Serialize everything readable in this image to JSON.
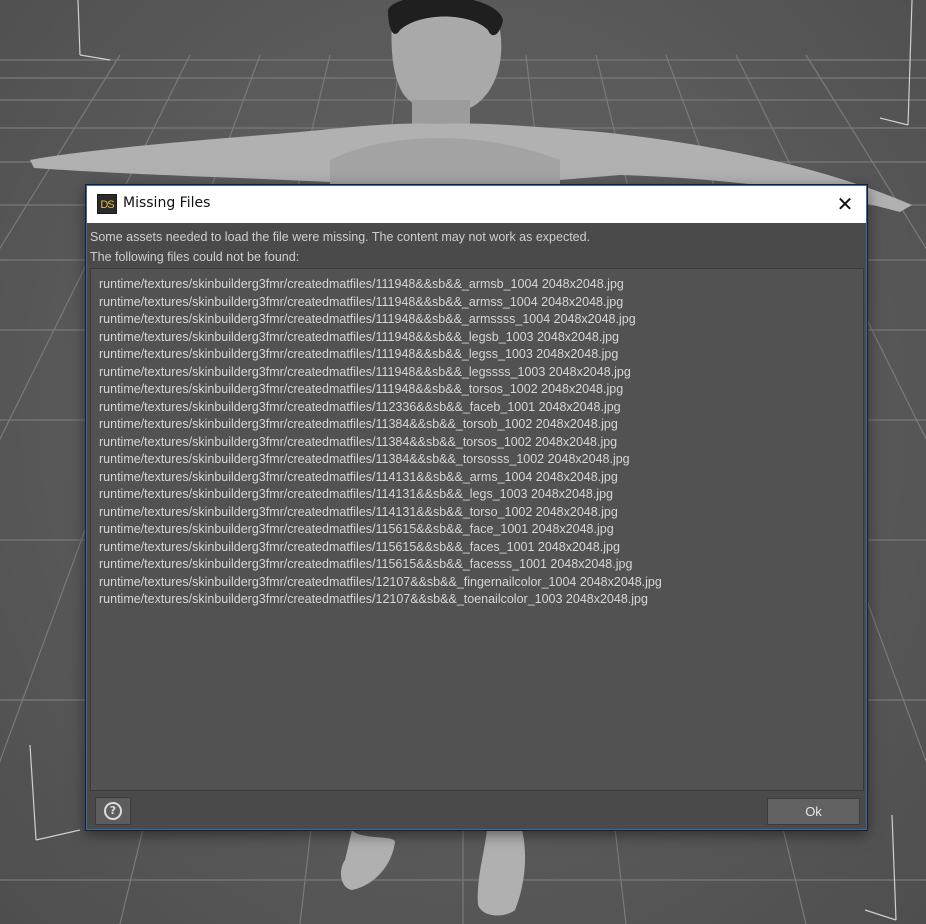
{
  "dialog": {
    "title": "Missing Files",
    "app_logo": "DS",
    "close_symbol": "✕",
    "message_line1": "Some assets needed to load the file were missing. The content may not work as expected.",
    "message_line2": "The following files could not be found:",
    "files": [
      "runtime/textures/skinbuilderg3fmr/createdmatfiles/111948&&sb&&_armsb_1004 2048x2048.jpg",
      "runtime/textures/skinbuilderg3fmr/createdmatfiles/111948&&sb&&_armss_1004 2048x2048.jpg",
      "runtime/textures/skinbuilderg3fmr/createdmatfiles/111948&&sb&&_armssss_1004 2048x2048.jpg",
      "runtime/textures/skinbuilderg3fmr/createdmatfiles/111948&&sb&&_legsb_1003 2048x2048.jpg",
      "runtime/textures/skinbuilderg3fmr/createdmatfiles/111948&&sb&&_legss_1003 2048x2048.jpg",
      "runtime/textures/skinbuilderg3fmr/createdmatfiles/111948&&sb&&_legssss_1003 2048x2048.jpg",
      "runtime/textures/skinbuilderg3fmr/createdmatfiles/111948&&sb&&_torsos_1002 2048x2048.jpg",
      "runtime/textures/skinbuilderg3fmr/createdmatfiles/112336&&sb&&_faceb_1001 2048x2048.jpg",
      "runtime/textures/skinbuilderg3fmr/createdmatfiles/11384&&sb&&_torsob_1002 2048x2048.jpg",
      "runtime/textures/skinbuilderg3fmr/createdmatfiles/11384&&sb&&_torsos_1002 2048x2048.jpg",
      "runtime/textures/skinbuilderg3fmr/createdmatfiles/11384&&sb&&_torsosss_1002 2048x2048.jpg",
      "runtime/textures/skinbuilderg3fmr/createdmatfiles/114131&&sb&&_arms_1004 2048x2048.jpg",
      "runtime/textures/skinbuilderg3fmr/createdmatfiles/114131&&sb&&_legs_1003 2048x2048.jpg",
      "runtime/textures/skinbuilderg3fmr/createdmatfiles/114131&&sb&&_torso_1002 2048x2048.jpg",
      "runtime/textures/skinbuilderg3fmr/createdmatfiles/115615&&sb&&_face_1001 2048x2048.jpg",
      "runtime/textures/skinbuilderg3fmr/createdmatfiles/115615&&sb&&_faces_1001 2048x2048.jpg",
      "runtime/textures/skinbuilderg3fmr/createdmatfiles/115615&&sb&&_facesss_1001 2048x2048.jpg",
      "runtime/textures/skinbuilderg3fmr/createdmatfiles/12107&&sb&&_fingernailcolor_1004 2048x2048.jpg",
      "runtime/textures/skinbuilderg3fmr/createdmatfiles/12107&&sb&&_toenailcolor_1003 2048x2048.jpg"
    ],
    "help_symbol": "?",
    "ok_label": "Ok"
  },
  "icons": {
    "help": "help-icon",
    "close": "close-icon",
    "logo": "daz-studio-logo-icon"
  },
  "colors": {
    "accent_border": "#2f6fb0",
    "dialog_bg": "#4a4a4a",
    "list_bg": "#525252",
    "viewport_bg": "#5a5a5a"
  }
}
